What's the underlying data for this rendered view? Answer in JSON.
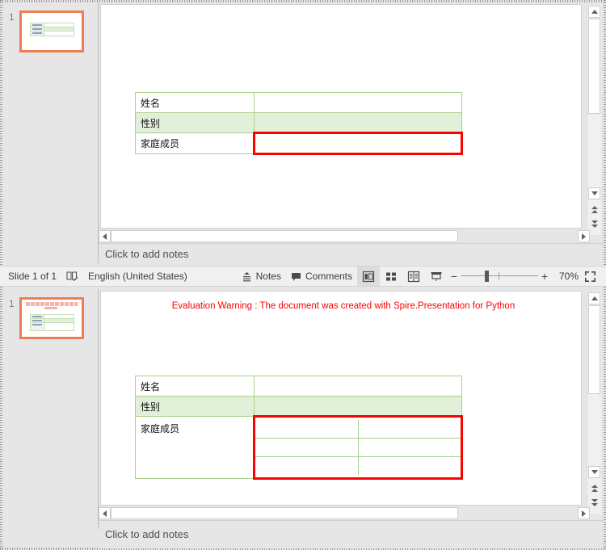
{
  "app": {
    "slide_thumbnail_number": "1"
  },
  "slide": {
    "eval_warning": "Evaluation Warning : The document was created with Spire.Presentation for Python",
    "table": {
      "rows": [
        {
          "label": "姓名",
          "value": "",
          "shaded": false
        },
        {
          "label": "性别",
          "value": "",
          "shaded": true
        },
        {
          "label": "家庭成员",
          "value": "",
          "shaded": false
        }
      ],
      "nested_rows": 3,
      "nested_cols": 2,
      "border_color": "#a9d08e",
      "shade_color": "#e2efd9",
      "highlight_color": "#ff0000"
    }
  },
  "notes": {
    "placeholder": "Click to add notes"
  },
  "status": {
    "slide_count": "Slide 1 of 1",
    "proofing_icon": "proofing-icon",
    "language": "English (United States)",
    "notes_label": "Notes",
    "comments_label": "Comments",
    "views": [
      {
        "name": "normal-view",
        "active": true
      },
      {
        "name": "slide-sorter-view",
        "active": false
      },
      {
        "name": "reading-view",
        "active": false
      },
      {
        "name": "slide-show-view",
        "active": false
      }
    ],
    "zoom_out": "−",
    "zoom_in": "+",
    "zoom_level": "70%",
    "fit_label": "fit-slide-to-window"
  },
  "colors": {
    "thumbnail_selection": "#ed7d57",
    "warning_text": "#ff0000",
    "chrome_bg": "#e6e6e6",
    "status_bg": "#f0f0f0"
  }
}
